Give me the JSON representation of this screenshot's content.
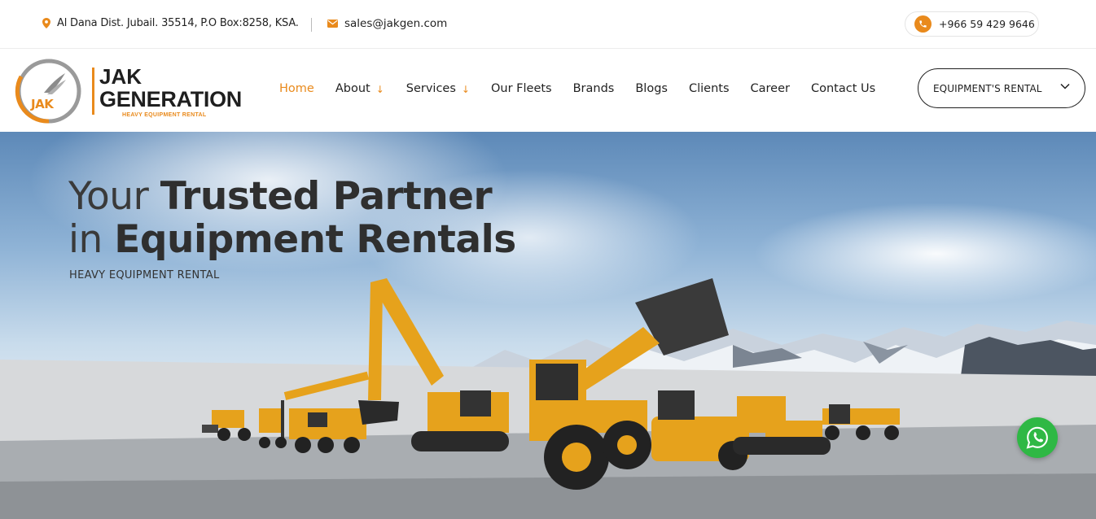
{
  "topbar": {
    "address": "Al Dana Dist. Jubail. 35514, P.O Box:8258, KSA.",
    "email": "sales@jakgen.com",
    "phone": "+966 59 429 9646",
    "icons": {
      "address": "map-pin-icon",
      "email": "envelope-icon",
      "phone": "phone-icon"
    }
  },
  "logo": {
    "mark": "JAK",
    "line1": "JAK",
    "line2": "GENERATION",
    "tagline": "HEAVY EQUIPMENT RENTAL"
  },
  "nav": {
    "items": [
      {
        "label": "Home",
        "active": true,
        "has_dropdown": false
      },
      {
        "label": "About",
        "active": false,
        "has_dropdown": true
      },
      {
        "label": "Services",
        "active": false,
        "has_dropdown": true
      },
      {
        "label": "Our Fleets",
        "active": false,
        "has_dropdown": false
      },
      {
        "label": "Brands",
        "active": false,
        "has_dropdown": false
      },
      {
        "label": "Blogs",
        "active": false,
        "has_dropdown": false
      },
      {
        "label": "Clients",
        "active": false,
        "has_dropdown": false
      },
      {
        "label": "Career",
        "active": false,
        "has_dropdown": false
      },
      {
        "label": "Contact Us",
        "active": false,
        "has_dropdown": false
      }
    ],
    "rental_button": "EQUIPMENT'S RENTAL"
  },
  "hero": {
    "title_line1_light": "Your ",
    "title_line1_bold": "Trusted Partner",
    "title_line2_light": "in ",
    "title_line2_bold": "Equipment Rentals",
    "subtitle": "HEAVY EQUIPMENT RENTAL",
    "image": "heavy-equipment-fleet-on-snowy-plain"
  },
  "floating": {
    "whatsapp": "whatsapp-icon"
  },
  "colors": {
    "accent": "#e98a1c",
    "dark": "#1f1f1f",
    "whatsapp": "#2fb845"
  }
}
